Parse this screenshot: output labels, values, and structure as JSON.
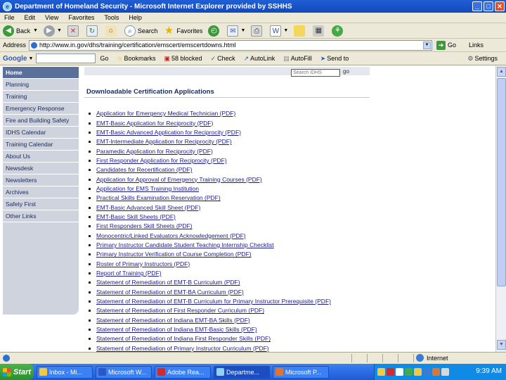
{
  "window": {
    "title": "Department of Homeland Security - Microsoft Internet Explorer provided by SSHHS"
  },
  "menu": [
    "File",
    "Edit",
    "View",
    "Favorites",
    "Tools",
    "Help"
  ],
  "toolbar": {
    "back": "Back",
    "search": "Search",
    "favorites": "Favorites"
  },
  "address": {
    "label": "Address",
    "url": "http://www.in.gov/dhs/training/certification/emscert/emscertdowns.html",
    "go": "Go",
    "links": "Links"
  },
  "googlebar": {
    "brand": "Google",
    "go": "Go",
    "bookmarks": "Bookmarks",
    "popups": "58 blocked",
    "check": "Check",
    "autolink": "AutoLink",
    "autofill": "AutoFill",
    "sendto": "Send to",
    "settings": "Settings"
  },
  "nav": [
    "Home",
    "Planning",
    "Training",
    "Emergency Response",
    "Fire and Building Safety",
    "IDHS Calendar",
    "Training Calendar",
    "About Us",
    "Newsdesk",
    "Newsletters",
    "Archives",
    "Safety First",
    "Other Links"
  ],
  "search": {
    "placeholder": "Search IDHS",
    "go": "go"
  },
  "page": {
    "title": "Downloadable Certification Applications",
    "links": [
      "Application for Emergency Medical Technician (PDF)",
      "EMT-Basic Application for Reciprocity (PDF)",
      "EMT-Basic Advanced Application for Reciprocity (PDF)",
      "EMT-Intermediate Application for Reciprocity (PDF)",
      "Paramedic Application for Reciprocity (PDF)",
      "First Responder Application for Reciprocity (PDF)",
      "Candidates for Recertification (PDF)",
      "Application for Approval of Emergency Training Courses (PDF)",
      "Application for EMS Training Institution",
      "Practical Skills Examination Reservation (PDF)",
      "EMT-Basic Advanced Skill Sheet (PDF)",
      "EMT-Basic Skill Sheets (PDF)",
      "First Responders Skill Sheets (PDF)",
      "Monocentric/Linked Evaluators Acknowledgement (PDF)",
      "Primary Instructor Candidate Student Teaching Internship Checklist",
      "Primary Instructor Verification of Course Completion (PDF)",
      "Roster of Primary Instructors (PDF)",
      "Report of Training (PDF)",
      "Statement of Remediation of EMT-B Curriculum (PDF)",
      "Statement of Remediation of EMT-BA Curriculum (PDF)",
      "Statement of Remediation of EMT-B Curriculum for Primary Instructor Prerequisite (PDF)",
      "Statement of Remediation of First Responder Curriculum (PDF)",
      "Statement of Remediation of Indiana EMT-BA Skills (PDF)",
      "Statement of Remediation of Indiana EMT-Basic Skills (PDF)",
      "Statement of Remediation of Indiana First Responder Skills (PDF)",
      "Statement of Remediation of Primary Instructor Curriculum (PDF)"
    ]
  },
  "status": {
    "zone": "Internet"
  },
  "taskbar": {
    "start": "Start",
    "tasks": [
      "Inbox - Mi...",
      "Microsoft W...",
      "Adobe Rea...",
      "Departme...",
      "Microsoft P..."
    ],
    "clock": "9:39 AM"
  },
  "colors": {
    "titlebar": "#1448b8",
    "nav_active": "#5a6f9a",
    "nav_bg": "#cfd3dd",
    "link": "#1a1a8a",
    "taskbar": "#1e5ad6",
    "start": "#2f8d30"
  }
}
